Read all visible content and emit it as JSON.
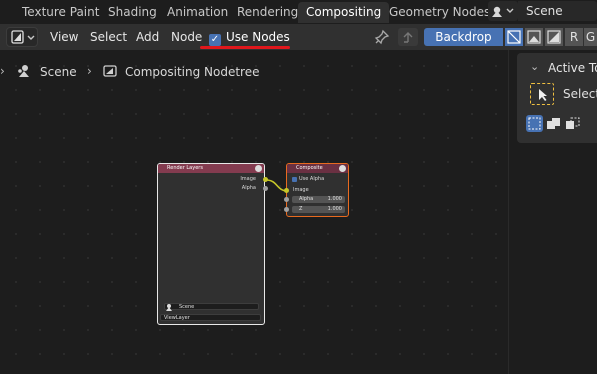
{
  "workspace_tabs": [
    "Texture Paint",
    "Shading",
    "Animation",
    "Rendering",
    "Compositing",
    "Geometry Nodes"
  ],
  "active_tab": "Compositing",
  "scene_name": "Scene",
  "header": {
    "menus": [
      "View",
      "Select",
      "Add",
      "Node"
    ],
    "use_nodes_label": "Use Nodes",
    "use_nodes_checked": true,
    "backdrop_label": "Backdrop",
    "channels": [
      "R",
      "G"
    ]
  },
  "breadcrumb": {
    "scene": "Scene",
    "nodetree": "Compositing Nodetree"
  },
  "nodes": {
    "render_layers": {
      "title": "Render Layers",
      "outputs": [
        "Image",
        "Alpha"
      ],
      "scene_field": "Scene",
      "view_layer": "ViewLayer"
    },
    "composite": {
      "title": "Composite",
      "use_alpha_label": "Use Alpha",
      "use_alpha_checked": true,
      "inputs": {
        "image": "Image",
        "alpha_label": "Alpha",
        "alpha_value": "1.000",
        "z_label": "Z",
        "z_value": "1.000"
      }
    }
  },
  "sidebar": {
    "panel_title": "Active Tool",
    "tool_label": "Select"
  },
  "colors": {
    "accent": "#4772b3",
    "annotation_underline": "#e0171c",
    "composite_border": "#e86a1f",
    "image_socket": "#c7c729",
    "render_layers_header": "#833b4f"
  }
}
